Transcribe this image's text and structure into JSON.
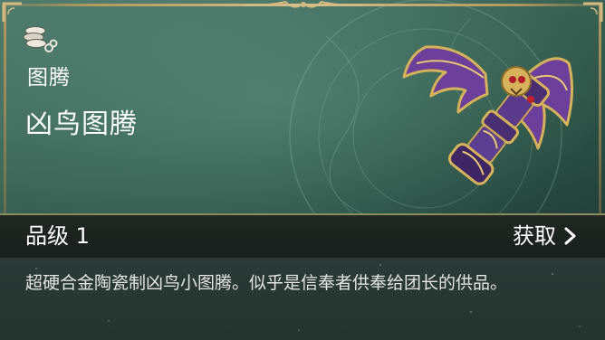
{
  "item": {
    "category": "图腾",
    "name": "凶鸟图腾",
    "category_icon": "stacked-coins-icon",
    "art_icon": "winged-totem-icon"
  },
  "rarity": {
    "label": "品级 1"
  },
  "obtain": {
    "label": "获取",
    "icon": "chevron-right-icon"
  },
  "description": "超硬合金陶瓷制凶鸟小图腾。似乎是信奉者供奉给团长的供品。",
  "colors": {
    "header_green": "#3f6a5c",
    "frame_gold": "#b59a5e",
    "bar_bg": "#1b221f",
    "desc_bg": "#2a3834",
    "text": "#ffffff"
  }
}
